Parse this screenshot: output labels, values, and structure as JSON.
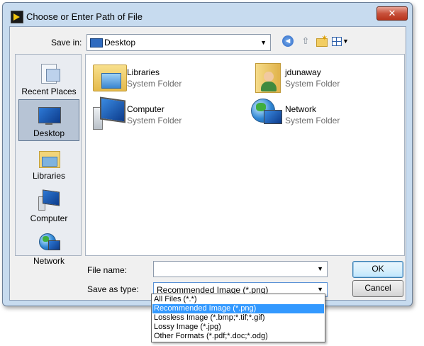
{
  "window": {
    "title": "Choose or Enter Path of File",
    "close_glyph": "✕"
  },
  "toolbar": {
    "save_in_label": "Save in:",
    "save_in_value": "Desktop",
    "back_icon": "back-arrow-icon",
    "up_icon": "up-folder-icon",
    "new_folder_icon": "new-folder-icon",
    "views_icon": "views-menu-icon"
  },
  "places": [
    {
      "label": "Recent Places",
      "icon": "recent-places-icon",
      "selected": false
    },
    {
      "label": "Desktop",
      "icon": "desktop-icon",
      "selected": true
    },
    {
      "label": "Libraries",
      "icon": "libraries-icon",
      "selected": false
    },
    {
      "label": "Computer",
      "icon": "computer-icon",
      "selected": false
    },
    {
      "label": "Network",
      "icon": "network-icon",
      "selected": false
    }
  ],
  "files": [
    {
      "name": "Libraries",
      "type": "System Folder",
      "icon": "libraries-folder-icon"
    },
    {
      "name": "jdunaway",
      "type": "System Folder",
      "icon": "user-folder-icon"
    },
    {
      "name": "Computer",
      "type": "System Folder",
      "icon": "computer-icon"
    },
    {
      "name": "Network",
      "type": "System Folder",
      "icon": "network-icon"
    }
  ],
  "form": {
    "file_name_label": "File name:",
    "file_name_value": "",
    "save_as_type_label": "Save as type:",
    "save_as_type_value": "Recommended Image (*.png)",
    "ok_label": "OK",
    "cancel_label": "Cancel",
    "dropdown_glyph": "▼"
  },
  "type_options": [
    {
      "label": "All Files (*.*)",
      "selected": false
    },
    {
      "label": "Recommended Image (*.png)",
      "selected": true
    },
    {
      "label": "Lossless Image (*.bmp;*.tif;*.gif)",
      "selected": false
    },
    {
      "label": "Lossy Image (*.jpg)",
      "selected": false
    },
    {
      "label": "Other Formats (*.pdf;*.doc;*.odg)",
      "selected": false
    }
  ]
}
